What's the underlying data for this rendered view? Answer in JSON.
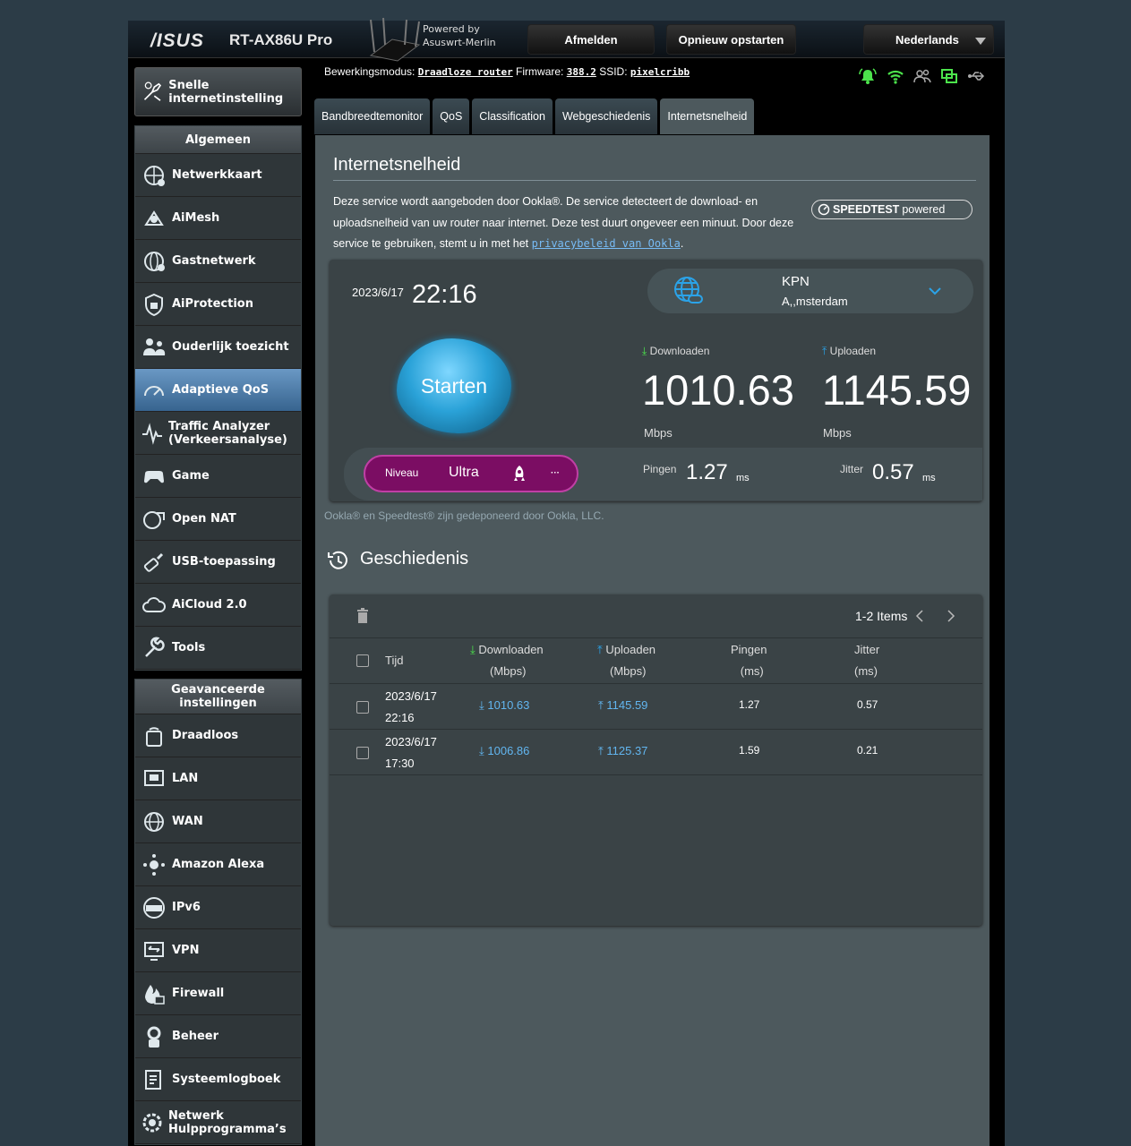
{
  "header": {
    "brand": "/ISUS",
    "model": "RT-AX86U Pro",
    "powered_by_line1": "Powered by",
    "powered_by_line2": "Asuswrt-Merlin",
    "logout_label": "Afmelden",
    "reboot_label": "Opnieuw opstarten",
    "language_label": "Nederlands"
  },
  "status": {
    "mode_label": "Bewerkingsmodus:",
    "mode_value": "Draadloze router",
    "firmware_label": "Firmware:",
    "firmware_value": "388.2",
    "ssid_label": "SSID:",
    "ssid_value": "pixelcribb"
  },
  "sidebar": {
    "quick_setup": "Snelle internetinstelling",
    "general_header": "Algemeen",
    "general_items": [
      {
        "label": "Netwerkkaart",
        "icon": "network-map-icon"
      },
      {
        "label": "AiMesh",
        "icon": "aimesh-icon"
      },
      {
        "label": "Gastnetwerk",
        "icon": "guest-network-icon"
      },
      {
        "label": "AiProtection",
        "icon": "shield-icon"
      },
      {
        "label": "Ouderlijk toezicht",
        "icon": "parental-control-icon"
      },
      {
        "label": "Adaptieve QoS",
        "icon": "gauge-icon"
      },
      {
        "label": "Traffic Analyzer (Verkeersanalyse)",
        "icon": "traffic-analyzer-icon"
      },
      {
        "label": "Game",
        "icon": "gamepad-icon"
      },
      {
        "label": "Open NAT",
        "icon": "open-nat-icon"
      },
      {
        "label": "USB-toepassing",
        "icon": "usb-icon"
      },
      {
        "label": "AiCloud 2.0",
        "icon": "cloud-icon"
      },
      {
        "label": "Tools",
        "icon": "wrench-icon"
      }
    ],
    "advanced_header": "Geavanceerde instellingen",
    "advanced_items": [
      {
        "label": "Draadloos",
        "icon": "wireless-icon"
      },
      {
        "label": "LAN",
        "icon": "lan-icon"
      },
      {
        "label": "WAN",
        "icon": "wan-icon"
      },
      {
        "label": "Amazon Alexa",
        "icon": "alexa-icon"
      },
      {
        "label": "IPv6",
        "icon": "ipv6-icon"
      },
      {
        "label": "VPN",
        "icon": "vpn-icon"
      },
      {
        "label": "Firewall",
        "icon": "firewall-icon"
      },
      {
        "label": "Beheer",
        "icon": "admin-icon"
      },
      {
        "label": "Systeemlogboek",
        "icon": "syslog-icon"
      },
      {
        "label": "Netwerk Hulpprogramma’s",
        "icon": "network-tools-icon"
      }
    ]
  },
  "tabs": [
    "Bandbreedtemonitor",
    "QoS",
    "Classification",
    "Webgeschiedenis",
    "Internetsnelheid"
  ],
  "main": {
    "title": "Internetsnelheid",
    "description": "Deze service wordt aangeboden door Ookla®. De service detecteert de download- en uploadsnelheid van uw router naar internet. Deze test duurt ongeveer een minuut. Door deze service te gebruiken, stemt u in met het ",
    "privacy_link": "privacybeleid van Ookla",
    "description_end": ".",
    "speedtest_logo_bold": "SPEEDTEST",
    "speedtest_logo_light": "powered",
    "trademark_note": "Ookla® en Speedtest® zijn gedeponeerd door Ookla, LLC."
  },
  "result": {
    "date": "2023/6/17",
    "time": "22:16",
    "server_isp": "KPN",
    "server_city": "A,,msterdam",
    "start_label": "Starten",
    "download_label": "Downloaden",
    "download_value": "1010.63",
    "download_unit": "Mbps",
    "upload_label": "Uploaden",
    "upload_value": "1145.59",
    "upload_unit": "Mbps",
    "level_label": "Niveau",
    "level_value": "Ultra",
    "more_label": "···",
    "ping_label": "Pingen",
    "ping_value": "1.27",
    "ping_unit": "ms",
    "jitter_label": "Jitter",
    "jitter_value": "0.57",
    "jitter_unit": "ms"
  },
  "history": {
    "title": "Geschiedenis",
    "pager": "1-2 Items",
    "headers": {
      "time": "Tijd",
      "download": "Downloaden",
      "download_unit": "(Mbps)",
      "upload": "Uploaden",
      "upload_unit": "(Mbps)",
      "ping": "Pingen",
      "ping_unit": "(ms)",
      "jitter": "Jitter",
      "jitter_unit": "(ms)"
    },
    "rows": [
      {
        "date": "2023/6/17",
        "time": "22:16",
        "download": "1010.63",
        "upload": "1145.59",
        "ping": "1.27",
        "jitter": "0.57"
      },
      {
        "date": "2023/6/17",
        "time": "17:30",
        "download": "1006.86",
        "upload": "1125.37",
        "ping": "1.59",
        "jitter": "0.21"
      }
    ]
  },
  "colors": {
    "accent_green": "#4ce44c",
    "link_blue": "#77bbf5",
    "level_purple": "#7b0d63",
    "active_menu": "#37648f"
  }
}
